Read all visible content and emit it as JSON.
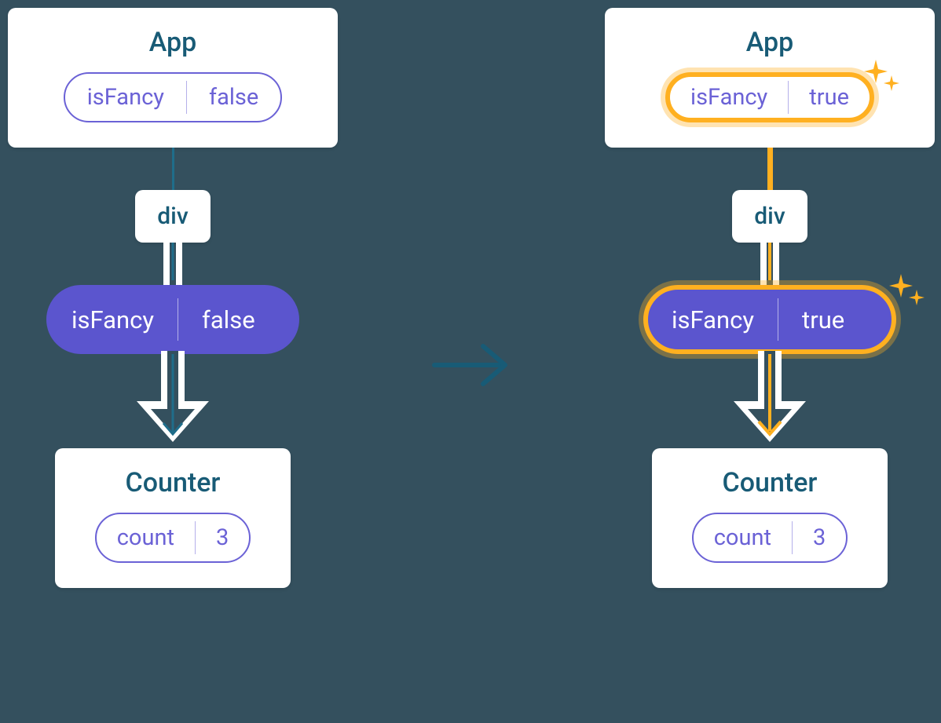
{
  "left": {
    "app_title": "App",
    "app_state_key": "isFancy",
    "app_state_val": "false",
    "div_label": "div",
    "prop_key": "isFancy",
    "prop_val": "false",
    "counter_title": "Counter",
    "counter_state_key": "count",
    "counter_state_val": "3"
  },
  "right": {
    "app_title": "App",
    "app_state_key": "isFancy",
    "app_state_val": "true",
    "div_label": "div",
    "prop_key": "isFancy",
    "prop_val": "true",
    "counter_title": "Counter",
    "counter_state_key": "count",
    "counter_state_val": "3"
  },
  "colors": {
    "bg": "#34505e",
    "teal": "#185b76",
    "purple": "#6b62d6",
    "purple_fill": "#5b55ce",
    "orange": "#ffb020"
  }
}
